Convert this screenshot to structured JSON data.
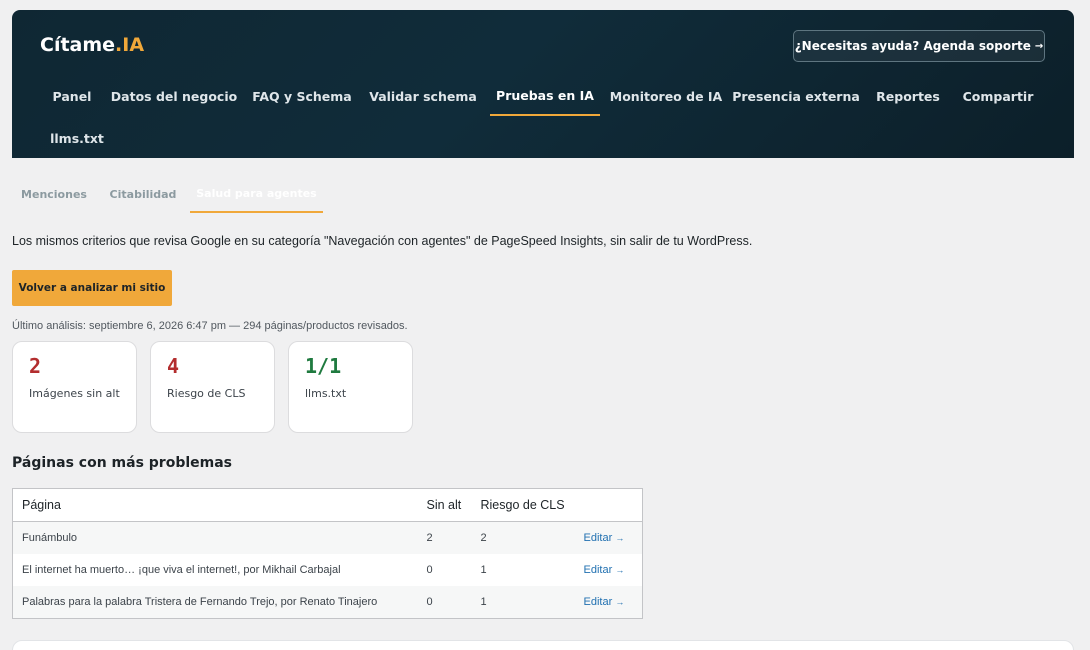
{
  "brand": {
    "name": "Cítame",
    "suffix": ".IA",
    "accent_color": "#f0a83a"
  },
  "help_button": {
    "label": "¿Necesitas ayuda? Agenda soporte",
    "arrow": "→"
  },
  "nav": [
    {
      "label": "Panel"
    },
    {
      "label": "Datos del negocio"
    },
    {
      "label": "FAQ y Schema"
    },
    {
      "label": "Validar schema"
    },
    {
      "label": "Pruebas en IA",
      "active": true
    },
    {
      "label": "Monitoreo de IA"
    },
    {
      "label": "Presencia externa"
    },
    {
      "label": "Reportes"
    },
    {
      "label": "Compartir"
    },
    {
      "label": "llms.txt"
    }
  ],
  "subtabs": [
    {
      "label": "Menciones"
    },
    {
      "label": "Citabilidad"
    },
    {
      "label": "Salud para agentes",
      "active": true
    }
  ],
  "intro_text": "Los mismos criterios que revisa Google en su categoría \"Navegación con agentes\" de PageSpeed Insights, sin salir de tu WordPress.",
  "analyze_button": {
    "label": "Volver a analizar mi sitio"
  },
  "last_analysis": "Último análisis: septiembre 6, 2026 6:47 pm — 294 páginas/productos revisados.",
  "metrics": [
    {
      "value": "2",
      "label": "Imágenes sin alt",
      "status": "bad"
    },
    {
      "value": "4",
      "label": "Riesgo de CLS",
      "status": "bad"
    },
    {
      "value": "1/1",
      "label": "llms.txt",
      "status": "good"
    }
  ],
  "status_colors": {
    "bad": "#b32d2e",
    "good": "#1f7a3f"
  },
  "problems": {
    "title": "Páginas con más problemas",
    "columns": [
      "Página",
      "Sin alt",
      "Riesgo de CLS",
      ""
    ],
    "rows": [
      {
        "page": "Funámbulo",
        "sin_alt": "2",
        "cls": "2",
        "action": "Editar",
        "arrow": "→"
      },
      {
        "page": "El internet ha muerto… ¡que viva el internet!, por Mikhail Carbajal",
        "sin_alt": "0",
        "cls": "1",
        "action": "Editar",
        "arrow": "→"
      },
      {
        "page": "Palabras para la palabra Tristera de Fernando Trejo, por Renato Tinajero",
        "sin_alt": "0",
        "cls": "1",
        "action": "Editar",
        "arrow": "→"
      }
    ]
  }
}
